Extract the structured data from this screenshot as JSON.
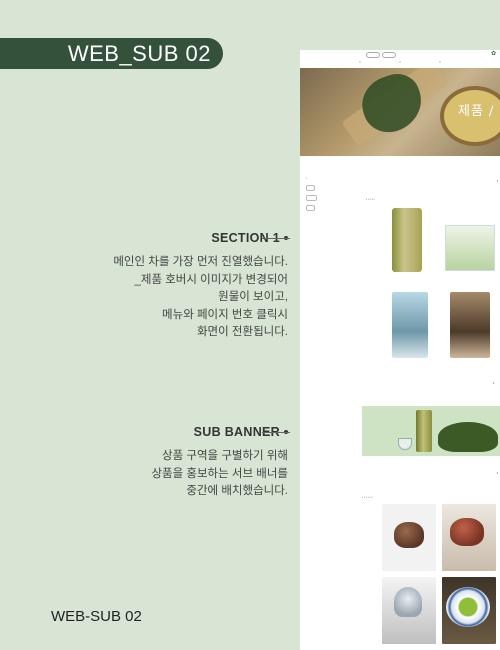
{
  "header": {
    "title": "WEB_SUB 02"
  },
  "footer": {
    "label": "WEB-SUB 02"
  },
  "sections": [
    {
      "title": "SECTION 1",
      "lines": [
        "메인인 차를 가장 먼저 진열했습니다.",
        "_제품 호버시 이미지가 변경되어",
        "원물이 보이고,",
        "메뉴와 페이지 번호 클릭시",
        "화면이 전환됩니다."
      ]
    },
    {
      "title": "SUB BANNER",
      "lines": [
        "상품 구역을 구별하기 위해",
        "상품을 홍보하는 서브 배너를",
        "중간에 배치했습니다."
      ]
    }
  ],
  "screenshot": {
    "hero_text": "제품 / Pr",
    "colors": {
      "background": "#d8e5d4",
      "pill": "#34513c",
      "banner": "#cde3c4"
    }
  }
}
